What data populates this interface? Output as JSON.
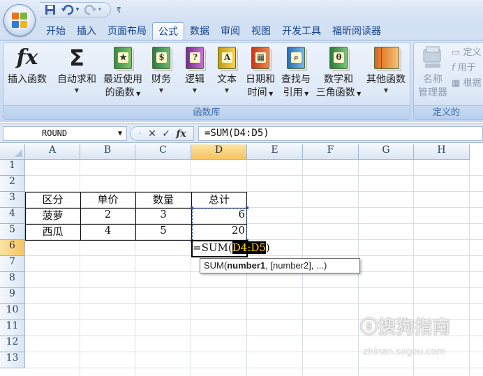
{
  "quick_access": {
    "save_icon": "save-icon",
    "undo_icon": "undo-icon",
    "redo_icon": "redo-icon",
    "customize_icon": "customize-icon"
  },
  "tabs": [
    "开始",
    "插入",
    "页面布局",
    "公式",
    "数据",
    "审阅",
    "视图",
    "开发工具",
    "福昕阅读器"
  ],
  "active_tab": "公式",
  "ribbon": {
    "buttons": {
      "insert_function": "插入函数",
      "autosum": "自动求和",
      "recent_line1": "最近使用",
      "recent_line2": "的函数",
      "financial": "财务",
      "logical": "逻辑",
      "text": "文本",
      "datetime_line1": "日期和",
      "datetime_line2": "时间",
      "lookup_line1": "查找与",
      "lookup_line2": "引用",
      "math_line1": "数学和",
      "math_line2": "三角函数",
      "more": "其他函数",
      "name_manager_line1": "名称",
      "name_manager_line2": "管理器",
      "define_name": "定义",
      "use_in_formula": "用于",
      "create_from_selection": "根据"
    },
    "book_glyphs": {
      "recent": "★",
      "financial": "$",
      "logical": "?",
      "text": "A",
      "datetime": "▦",
      "lookup": "⌕",
      "math": "θ",
      "more": ""
    },
    "group_labels": {
      "library": "函数库",
      "defined_names": "定义的"
    }
  },
  "formula_bar": {
    "name_box": "ROUND",
    "cancel": "✕",
    "enter": "✓",
    "fx": "fx",
    "content": "=SUM(D4:D5)"
  },
  "columns": [
    "A",
    "B",
    "C",
    "D",
    "E",
    "F",
    "G",
    "H"
  ],
  "rows": [
    "1",
    "2",
    "3",
    "4",
    "5",
    "6",
    "7",
    "8",
    "9",
    "10",
    "11",
    "12",
    "13"
  ],
  "cells": {
    "A3": "区分",
    "B3": "单价",
    "C3": "数量",
    "D3": "总计",
    "A4": "菠萝",
    "B4": "2",
    "C4": "3",
    "D4": "6",
    "A5": "西瓜",
    "B5": "4",
    "C5": "5",
    "D5": "20"
  },
  "editing": {
    "prefix": "=SUM(",
    "range": "D4:D5",
    "suffix": ")"
  },
  "tooltip": {
    "func": "SUM(",
    "arg1": "number1",
    "rest": ", [number2], ...)"
  },
  "watermark": {
    "main": "ⓢ搜狗指南",
    "sub": "zhinan.sogou.com"
  }
}
